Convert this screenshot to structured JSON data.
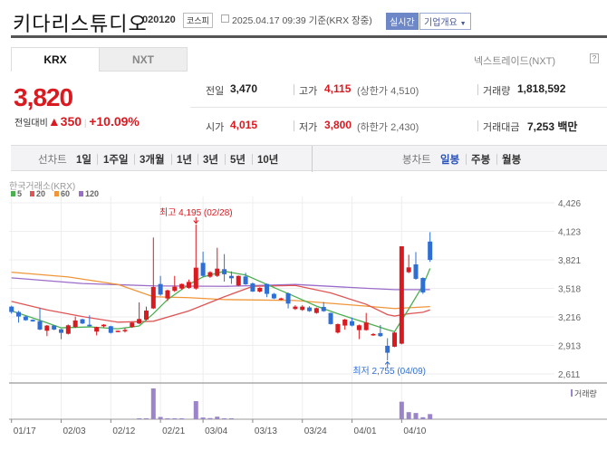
{
  "header": {
    "title": "키다리스튜디오",
    "code": "020120",
    "market": "코스피",
    "timestamp": "2025.04.17 09:39 기준(KRX 장중)",
    "realtime_label": "실시간",
    "overview_label": "기업개요"
  },
  "tabs": [
    {
      "label": "KRX",
      "active": true
    },
    {
      "label": "NXT",
      "active": false
    }
  ],
  "nextrade_label": "넥스트레이드(NXT)",
  "help_icon": "?",
  "quote": {
    "price": "3,820",
    "change_label": "전일대비",
    "change_arrow": "▲",
    "change": "350",
    "change_pct": "+10.09%",
    "prev_label": "전일",
    "prev": "3,470",
    "high_label": "고가",
    "high": "4,115",
    "upper_limit": "(상한가 4,510)",
    "volume_label": "거래량",
    "volume": "1,818,592",
    "open_label": "시가",
    "open": "4,015",
    "low_label": "저가",
    "low": "3,800",
    "lower_limit": "(하한가 2,430)",
    "amount_label": "거래대금",
    "amount": "7,253 백만"
  },
  "period": {
    "line_label": "선차트",
    "line_items": [
      "1일",
      "1주일",
      "3개월",
      "1년",
      "3년",
      "5년",
      "10년"
    ],
    "candle_label": "봉차트",
    "candle_items": [
      "일봉",
      "주봉",
      "월봉"
    ],
    "active": "일봉"
  },
  "colors": {
    "up": "#d91a20",
    "down": "#2f6fd4",
    "ma5": "#4caf50",
    "ma20": "#e05555",
    "ma60": "#f0963a",
    "ma120": "#9b6cc9",
    "volume": "#9b84c9"
  },
  "chart_data": {
    "type": "candlestick",
    "source_label": "한국거래소(KRX)",
    "legend": [
      "5",
      "20",
      "60",
      "120"
    ],
    "y_ticks": [
      "4,426",
      "4,123",
      "3,821",
      "3,518",
      "3,216",
      "2,913",
      "2,611"
    ],
    "ylim": [
      2611,
      4426
    ],
    "x_ticks": [
      {
        "label": "01/17",
        "i": 0
      },
      {
        "label": "02/03",
        "i": 7
      },
      {
        "label": "02/12",
        "i": 14
      },
      {
        "label": "02/21",
        "i": 21
      },
      {
        "label": "03/04",
        "i": 27
      },
      {
        "label": "03/13",
        "i": 34
      },
      {
        "label": "03/24",
        "i": 41
      },
      {
        "label": "04/01",
        "i": 48
      },
      {
        "label": "04/10",
        "i": 55
      }
    ],
    "high_annotation": "최고 4,195 (02/28)",
    "high_index": 26,
    "high_value": 4195,
    "low_annotation": "최저 2,755 (04/09)",
    "low_index": 53,
    "low_value": 2755,
    "volume_label": "거래량",
    "ohlc": [
      [
        3325,
        3335,
        3250,
        3268
      ],
      [
        3268,
        3280,
        3155,
        3220
      ],
      [
        3220,
        3230,
        3175,
        3181
      ],
      [
        3185,
        3190,
        3165,
        3168
      ],
      [
        3171,
        3309,
        3075,
        3082
      ],
      [
        3069,
        3130,
        3012,
        3124
      ],
      [
        3124,
        3130,
        3075,
        3082
      ],
      [
        3085,
        3090,
        2980,
        3047
      ],
      [
        3037,
        3135,
        3030,
        3127
      ],
      [
        3108,
        3220,
        3100,
        3178
      ],
      [
        3191,
        3195,
        3140,
        3146
      ],
      [
        3133,
        3233,
        3115,
        3117
      ],
      [
        3060,
        3112,
        3020,
        3108
      ],
      [
        3117,
        3140,
        3105,
        3133
      ],
      [
        3117,
        3122,
        3040,
        3047
      ],
      [
        3060,
        3070,
        3055,
        3069
      ],
      [
        3066,
        3099,
        3050,
        3078
      ],
      [
        3108,
        3160,
        3100,
        3156
      ],
      [
        3146,
        3370,
        3140,
        3194
      ],
      [
        3187,
        3325,
        3180,
        3283
      ],
      [
        3306,
        4058,
        3300,
        3533
      ],
      [
        3565,
        3651,
        3440,
        3453
      ],
      [
        3412,
        3505,
        3385,
        3498
      ],
      [
        3492,
        3651,
        3480,
        3536
      ],
      [
        3517,
        3570,
        3505,
        3565
      ],
      [
        3524,
        3612,
        3515,
        3587
      ],
      [
        3517,
        4195,
        3505,
        3738
      ],
      [
        3789,
        3908,
        3640,
        3651
      ],
      [
        3642,
        3700,
        3630,
        3690
      ],
      [
        3651,
        3949,
        3640,
        3728
      ],
      [
        3722,
        3882,
        3590,
        3668
      ],
      [
        3651,
        3699,
        3566,
        3626
      ],
      [
        3549,
        3655,
        3540,
        3651
      ],
      [
        3645,
        3684,
        3555,
        3562
      ],
      [
        3571,
        3580,
        3480,
        3485
      ],
      [
        3485,
        3530,
        3475,
        3524
      ],
      [
        3565,
        3570,
        3425,
        3460
      ],
      [
        3460,
        3470,
        3405,
        3412
      ],
      [
        3402,
        3420,
        3395,
        3412
      ],
      [
        3466,
        3475,
        3306,
        3357
      ],
      [
        3300,
        3340,
        3290,
        3325
      ],
      [
        3290,
        3340,
        3280,
        3325
      ],
      [
        3316,
        3330,
        3270,
        3277
      ],
      [
        3258,
        3315,
        3250,
        3309
      ],
      [
        3322,
        3373,
        3270,
        3277
      ],
      [
        3258,
        3262,
        3135,
        3140
      ],
      [
        3050,
        3145,
        3040,
        3140
      ],
      [
        3124,
        3195,
        3080,
        3188
      ],
      [
        3171,
        3210,
        3115,
        3124
      ],
      [
        3076,
        3135,
        2980,
        3127
      ],
      [
        3076,
        3258,
        3070,
        3156
      ],
      [
        3024,
        3044,
        3015,
        3034
      ],
      [
        3044,
        3130,
        3005,
        3012
      ],
      [
        2909,
        2990,
        2755,
        2836
      ],
      [
        2900,
        3055,
        2895,
        3050
      ],
      [
        2932,
        3965,
        2925,
        3965
      ],
      [
        3690,
        3875,
        3680,
        3741
      ],
      [
        3773,
        3904,
        3610,
        3620
      ],
      [
        3629,
        3635,
        3460,
        3476
      ],
      [
        4015,
        4115,
        3800,
        3820
      ]
    ],
    "ma": {
      "ma5": [
        [
          0,
          3280
        ],
        [
          4,
          3180
        ],
        [
          7,
          3100
        ],
        [
          11,
          3110
        ],
        [
          15,
          3090
        ],
        [
          18,
          3120
        ],
        [
          20,
          3250
        ],
        [
          22,
          3400
        ],
        [
          25,
          3560
        ],
        [
          27,
          3640
        ],
        [
          30,
          3700
        ],
        [
          33,
          3660
        ],
        [
          36,
          3560
        ],
        [
          40,
          3430
        ],
        [
          43,
          3330
        ],
        [
          46,
          3250
        ],
        [
          48,
          3200
        ],
        [
          51,
          3130
        ],
        [
          53,
          3080
        ],
        [
          54,
          3060
        ],
        [
          56,
          3300
        ],
        [
          58,
          3550
        ],
        [
          59,
          3730
        ]
      ],
      "ma20": [
        [
          0,
          3380
        ],
        [
          5,
          3290
        ],
        [
          10,
          3220
        ],
        [
          15,
          3160
        ],
        [
          20,
          3170
        ],
        [
          25,
          3280
        ],
        [
          30,
          3430
        ],
        [
          34,
          3540
        ],
        [
          40,
          3550
        ],
        [
          45,
          3470
        ],
        [
          50,
          3350
        ],
        [
          53,
          3240
        ],
        [
          54,
          3225
        ],
        [
          56,
          3250
        ],
        [
          58,
          3265
        ],
        [
          59,
          3290
        ]
      ],
      "ma60": [
        [
          0,
          3690
        ],
        [
          8,
          3640
        ],
        [
          15,
          3560
        ],
        [
          20,
          3430
        ],
        [
          25,
          3420
        ],
        [
          30,
          3400
        ],
        [
          40,
          3390
        ],
        [
          50,
          3330
        ],
        [
          54,
          3305
        ],
        [
          59,
          3325
        ]
      ],
      "ma120": [
        [
          0,
          3630
        ],
        [
          10,
          3570
        ],
        [
          20,
          3545
        ],
        [
          30,
          3540
        ],
        [
          40,
          3560
        ],
        [
          50,
          3520
        ],
        [
          54,
          3505
        ],
        [
          59,
          3505
        ]
      ]
    },
    "volume": {
      "unit": "shares (approx.)",
      "values": [
        [
          18,
          190000
        ],
        [
          19,
          210000
        ],
        [
          20,
          10900000
        ],
        [
          21,
          800000
        ],
        [
          22,
          300000
        ],
        [
          23,
          300000
        ],
        [
          24,
          300000
        ],
        [
          26,
          6400000
        ],
        [
          27,
          600000
        ],
        [
          28,
          400000
        ],
        [
          29,
          900000
        ],
        [
          30,
          300000
        ],
        [
          31,
          300000
        ],
        [
          55,
          6200000
        ],
        [
          56,
          2500000
        ],
        [
          57,
          2200000
        ],
        [
          58,
          700000
        ],
        [
          59,
          1818592
        ]
      ]
    }
  }
}
